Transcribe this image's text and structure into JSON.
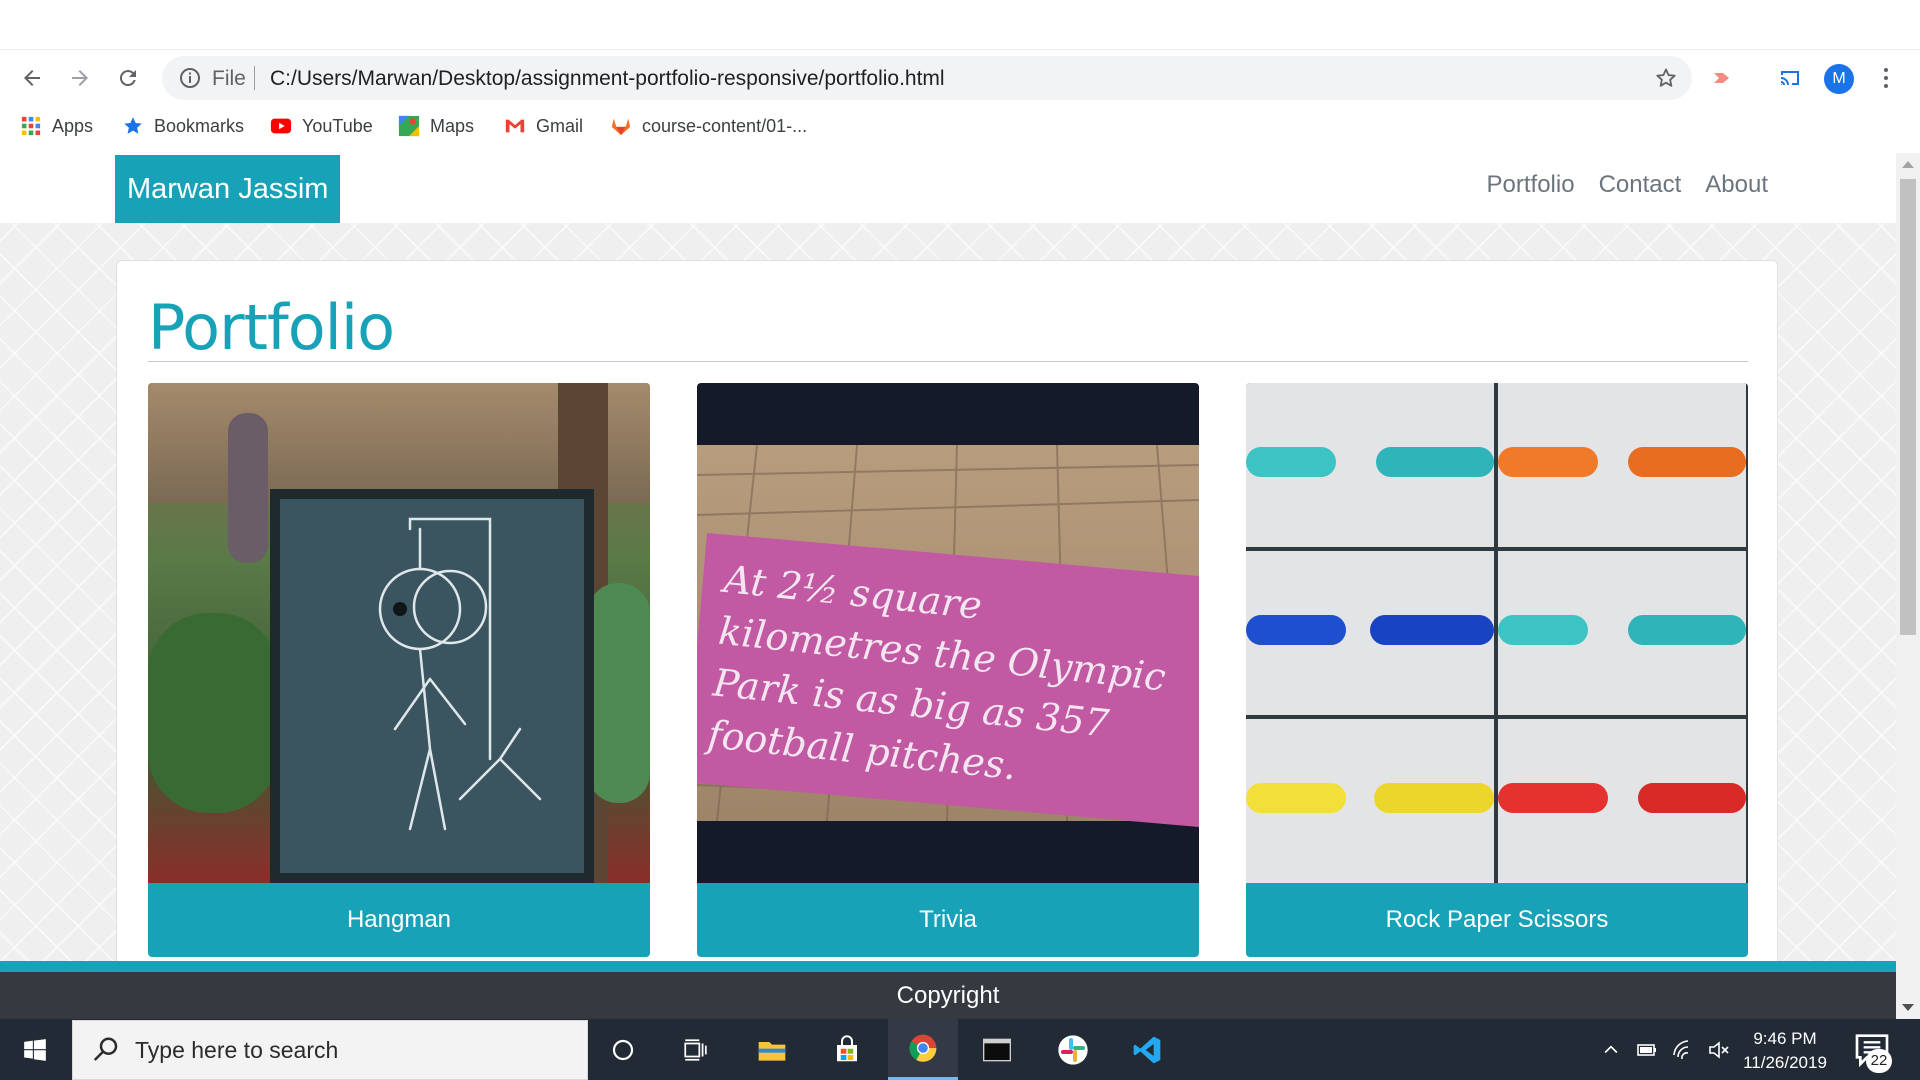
{
  "browser": {
    "omnibox": {
      "scheme_label": "File",
      "url": "C:/Users/Marwan/Desktop/assignment-portfolio-responsive/portfolio.html"
    },
    "profile_initial": "M",
    "bookmarks": [
      {
        "label": "Apps",
        "icon": "apps-grid-icon"
      },
      {
        "label": "Bookmarks",
        "icon": "star-icon"
      },
      {
        "label": "YouTube",
        "icon": "youtube-icon"
      },
      {
        "label": "Maps",
        "icon": "maps-icon"
      },
      {
        "label": "Gmail",
        "icon": "gmail-icon"
      },
      {
        "label": "course-content/01-...",
        "icon": "gitlab-icon"
      }
    ]
  },
  "site": {
    "brand": "Marwan Jassim",
    "nav": [
      "Portfolio",
      "Contact",
      "About"
    ],
    "section_title": "Portfolio",
    "projects": [
      {
        "title": "Hangman"
      },
      {
        "title": "Trivia",
        "image_text": "At 2½ square kilometres the Olympic Park is as big as 357 football pitches."
      },
      {
        "title": "Rock Paper Scissors"
      }
    ],
    "footer": "Copyright",
    "accent": "#17a2b8",
    "footer_bg": "#343a40"
  },
  "taskbar": {
    "search_placeholder": "Type here to search",
    "time": "9:46 PM",
    "date": "11/26/2019",
    "notification_count": "22",
    "apps": [
      "cortana-icon",
      "task-view-icon",
      "file-explorer-icon",
      "store-icon",
      "chrome-icon",
      "terminal-icon",
      "slack-icon",
      "vscode-icon"
    ]
  }
}
